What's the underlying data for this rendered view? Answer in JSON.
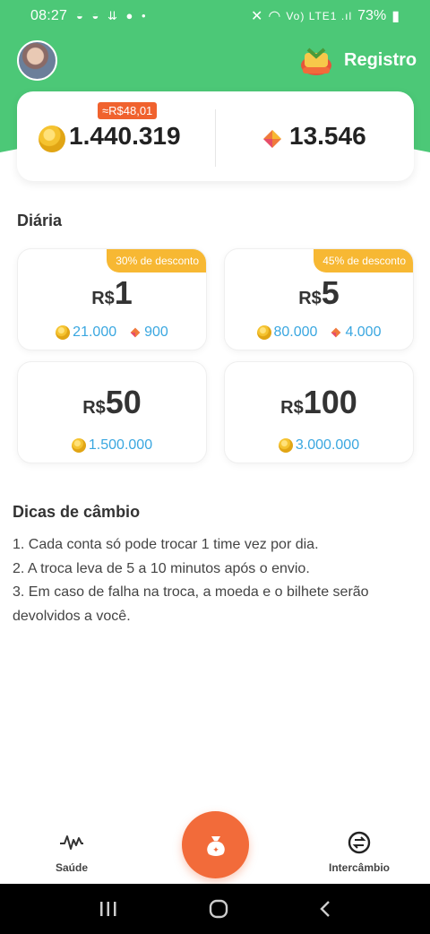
{
  "status_bar": {
    "time": "08:27",
    "icons_left": "◒ ◒ ⇊ ● •",
    "battery": "73%",
    "network": "Vo) LTE1 .ıl"
  },
  "header": {
    "register_label": "Registro"
  },
  "balance": {
    "coins": "1.440.319",
    "coins_brl": "≈R$48,01",
    "tickets": "13.546"
  },
  "daily": {
    "title": "Diária",
    "currency": "R$",
    "packages": [
      {
        "amount": "1",
        "discount": "30% de desconto",
        "coins": "21.000",
        "tickets": "900"
      },
      {
        "amount": "5",
        "discount": "45% de desconto",
        "coins": "80.000",
        "tickets": "4.000"
      },
      {
        "amount": "50",
        "coins": "1.500.000"
      },
      {
        "amount": "100",
        "coins": "3.000.000"
      }
    ]
  },
  "tips": {
    "title": "Dicas de câmbio",
    "lines": [
      "1. Cada conta só pode trocar 1 time vez por dia.",
      "2. A troca leva de 5 a 10 minutos após o envio.",
      "3. Em caso de falha na troca, a moeda e o bilhete serão devolvidos a você."
    ]
  },
  "bottom_nav": {
    "health_label": "Saúde",
    "exchange_label": "Intercâmbio"
  },
  "colors": {
    "green": "#4cc877",
    "orange": "#f26b3a",
    "discount": "#f7b833",
    "reward_blue": "#3aa7e0"
  }
}
